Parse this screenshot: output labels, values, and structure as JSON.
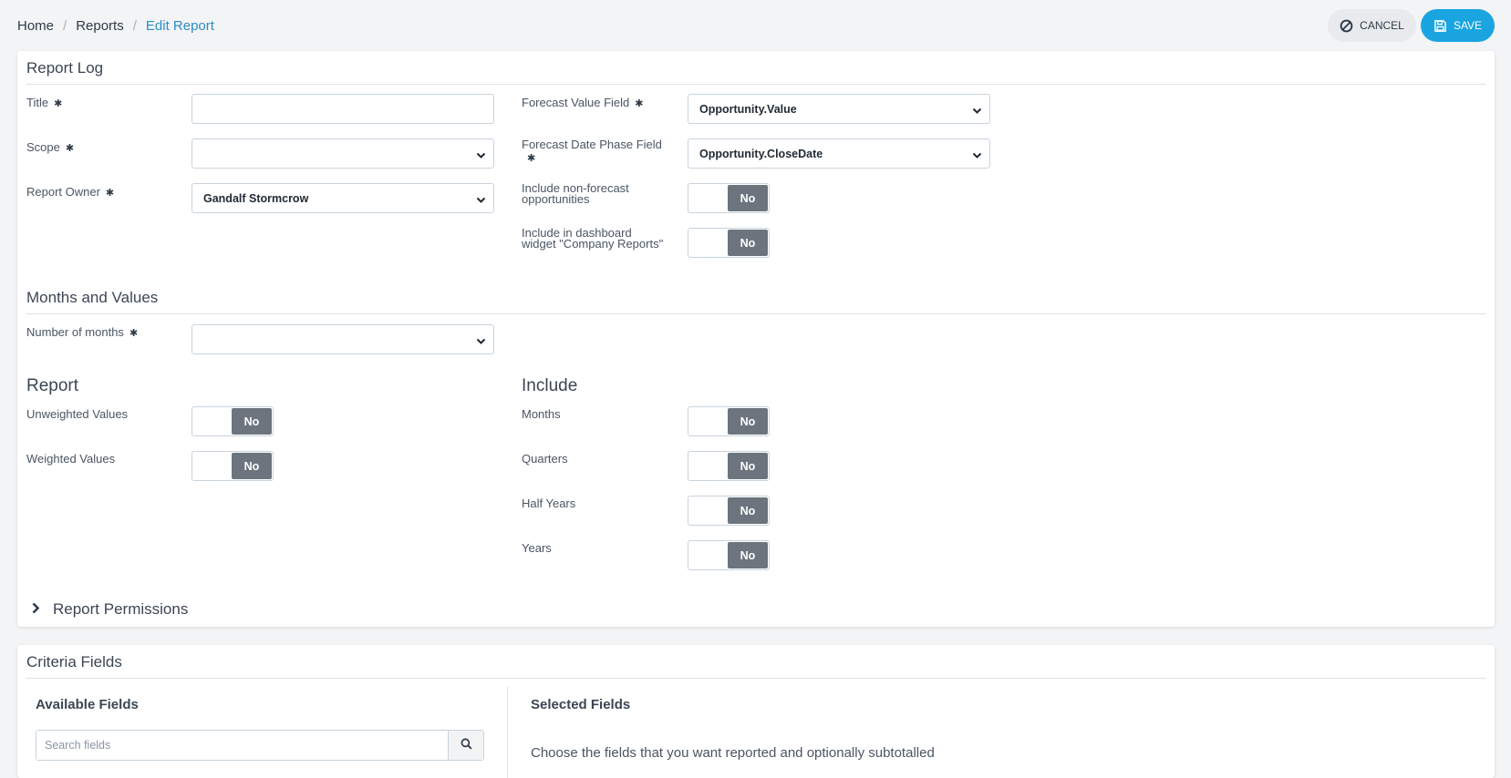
{
  "breadcrumb": {
    "home": "Home",
    "reports": "Reports",
    "current": "Edit Report",
    "separator": "/"
  },
  "actions": {
    "cancel_label": "CANCEL",
    "save_label": "SAVE"
  },
  "report_log": {
    "title": "Report Log",
    "fields": {
      "title_label": "Title",
      "title_value": "",
      "scope_label": "Scope",
      "scope_value": "",
      "owner_label": "Report Owner",
      "owner_value": "Gandalf Stormcrow",
      "forecast_value_label": "Forecast Value Field",
      "forecast_value_value": "Opportunity.Value",
      "forecast_date_label_line1": "Forecast Date Phase Field",
      "forecast_date_value": "Opportunity.CloseDate",
      "include_nonforecast_line1": "Include non-forecast",
      "include_nonforecast_line2": "opportunities",
      "include_nonforecast_value": "No",
      "include_dashboard_line1": "Include in dashboard",
      "include_dashboard_line2": "widget \"Company Reports\"",
      "include_dashboard_value": "No"
    },
    "required_mark": "✱"
  },
  "months_values": {
    "title": "Months and Values",
    "months_label": "Number of months",
    "months_value": ""
  },
  "report": {
    "title": "Report",
    "unweighted_label": "Unweighted Values",
    "unweighted_value": "No",
    "weighted_label": "Weighted Values",
    "weighted_value": "No"
  },
  "include": {
    "title": "Include",
    "months_label": "Months",
    "months_value": "No",
    "quarters_label": "Quarters",
    "quarters_value": "No",
    "half_years_label": "Half Years",
    "half_years_value": "No",
    "years_label": "Years",
    "years_value": "No"
  },
  "permissions": {
    "title": "Report Permissions"
  },
  "criteria": {
    "title": "Criteria Fields",
    "available_title": "Available Fields",
    "search_placeholder": "Search fields",
    "selected_title": "Selected Fields",
    "help_text": "Choose the fields that you want reported and optionally subtotalled"
  },
  "colors": {
    "accent": "#1aa5e0",
    "toggle_off": "#6c757d",
    "link_active": "#2a8ec4"
  }
}
